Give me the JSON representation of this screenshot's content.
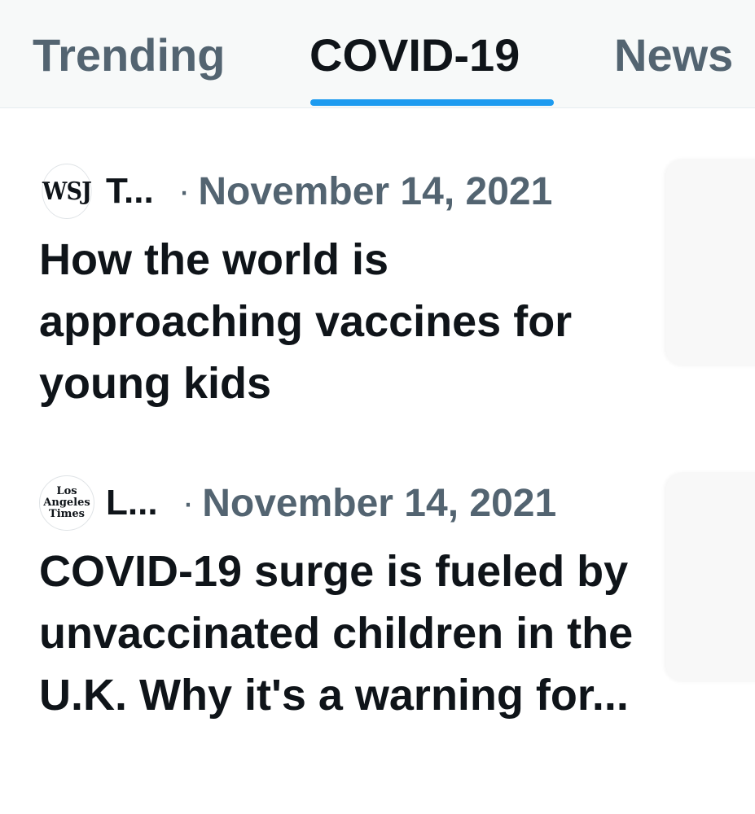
{
  "tabs": [
    {
      "label": "Trending",
      "selected": false
    },
    {
      "label": "COVID-19",
      "selected": true
    },
    {
      "label": "News",
      "selected": false
    }
  ],
  "accent_color": "#1d9bf0",
  "articles": [
    {
      "logo_text": "WSJ",
      "logo_icon": "wsj-logo",
      "source": "T...",
      "separator": "·",
      "date": "November 14, 2021",
      "headline": "How the world is approaching vaccines for young kids"
    },
    {
      "logo_text": "Los Angeles Times",
      "logo_lines": [
        "Los",
        "Angeles",
        "Times"
      ],
      "logo_icon": "la-times-logo",
      "source": "L...",
      "separator": "·",
      "date": "November 14, 2021",
      "headline": "COVID-19 surge is fueled by unvaccinated children in the U.K. Why it's a warning for..."
    }
  ]
}
